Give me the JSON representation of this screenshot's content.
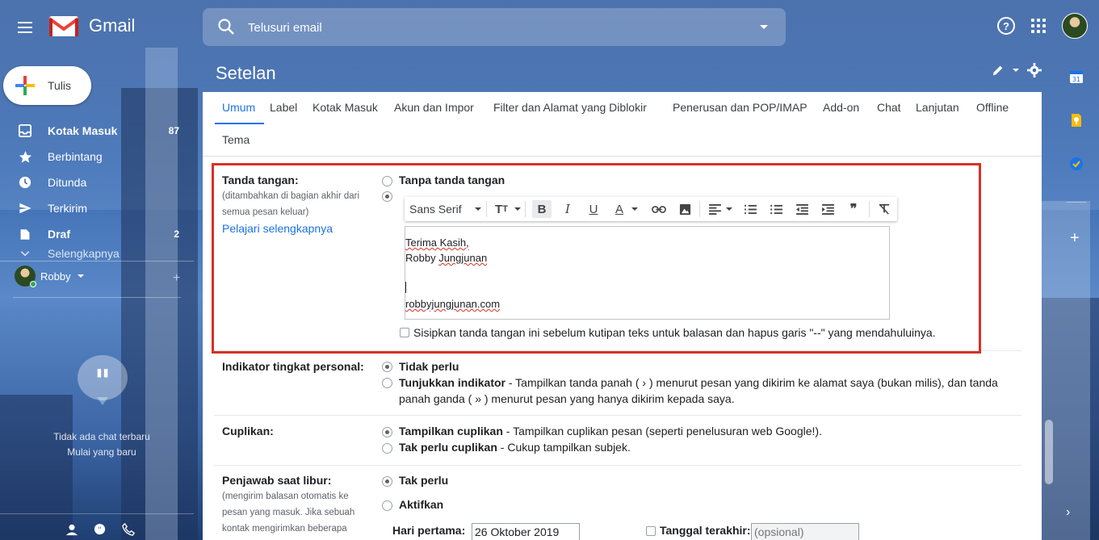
{
  "app": {
    "name": "Gmail"
  },
  "search": {
    "placeholder": "Telusuri email"
  },
  "compose": {
    "label": "Tulis"
  },
  "nav": [
    {
      "label": "Kotak Masuk",
      "count": "87",
      "icon": "inbox-icon",
      "bold": true
    },
    {
      "label": "Berbintang",
      "count": "",
      "icon": "star-icon",
      "bold": false
    },
    {
      "label": "Ditunda",
      "count": "",
      "icon": "clock-icon",
      "bold": false
    },
    {
      "label": "Terkirim",
      "count": "",
      "icon": "send-icon",
      "bold": false
    },
    {
      "label": "Draf",
      "count": "2",
      "icon": "draft-icon",
      "bold": true
    },
    {
      "label": "Selengkapnya",
      "count": "",
      "icon": "chevron-down-icon",
      "bold": false
    }
  ],
  "hangouts": {
    "user": "Robby",
    "empty_line1": "Tidak ada chat terbaru",
    "empty_line2": "Mulai yang baru"
  },
  "page": {
    "title": "Setelan"
  },
  "tabs": [
    {
      "label": "Umum",
      "active": true
    },
    {
      "label": "Label"
    },
    {
      "label": "Kotak Masuk"
    },
    {
      "label": "Akun dan Impor"
    },
    {
      "label": "Filter dan Alamat yang Diblokir"
    },
    {
      "label": "Penerusan dan POP/IMAP"
    },
    {
      "label": "Add-on"
    },
    {
      "label": "Chat"
    },
    {
      "label": "Lanjutan"
    },
    {
      "label": "Offline"
    },
    {
      "label": "Tema"
    }
  ],
  "signature": {
    "label": "Tanda tangan:",
    "sub1": "(ditambahkan di bagian akhir dari",
    "sub2": "semua pesan keluar)",
    "learn_more": "Pelajari selengkapnya",
    "option_none": "Tanpa tanda tangan",
    "font": "Sans Serif",
    "line1": "Terima Kasih,",
    "line2_a": "Robby ",
    "line2_b": "Jungjunan",
    "line4": "robbyjungjunan.com",
    "insert_before_quote": "Sisipkan tanda tangan ini sebelum kutipan teks untuk balasan dan hapus garis \"--\" yang mendahuluinya."
  },
  "personal_indicator": {
    "label": "Indikator tingkat personal:",
    "option_none": "Tidak perlu",
    "option_show_bold": "Tunjukkan indikator",
    "option_show_desc1": " - Tampilkan tanda panah ( › ) menurut pesan yang dikirim ke alamat saya (bukan milis), dan tanda",
    "option_show_desc2": "panah ganda ( » ) menurut pesan yang hanya dikirim kepada saya."
  },
  "snippets": {
    "label": "Cuplikan:",
    "option_show_bold": "Tampilkan cuplikan",
    "option_show_desc": " - Tampilkan cuplikan pesan (seperti penelusuran web Google!).",
    "option_hide_bold": "Tak perlu cuplikan",
    "option_hide_desc": " - Cukup tampilkan subjek."
  },
  "vacation": {
    "label": "Penjawab saat libur:",
    "sub1": "(mengirim balasan otomatis ke",
    "sub2": "pesan yang masuk. Jika sebuah",
    "sub3": "kontak mengirimkan beberapa",
    "option_off": "Tak perlu",
    "option_on": "Aktifkan",
    "first_day_label": "Hari pertama:",
    "first_day_value": "26 Oktober 2019",
    "last_day_label": "Tanggal terakhir:",
    "last_day_placeholder": "(opsional)"
  },
  "calendar_badge": "31",
  "colors": {
    "accent": "#1a73e8",
    "highlight": "#d93025"
  }
}
